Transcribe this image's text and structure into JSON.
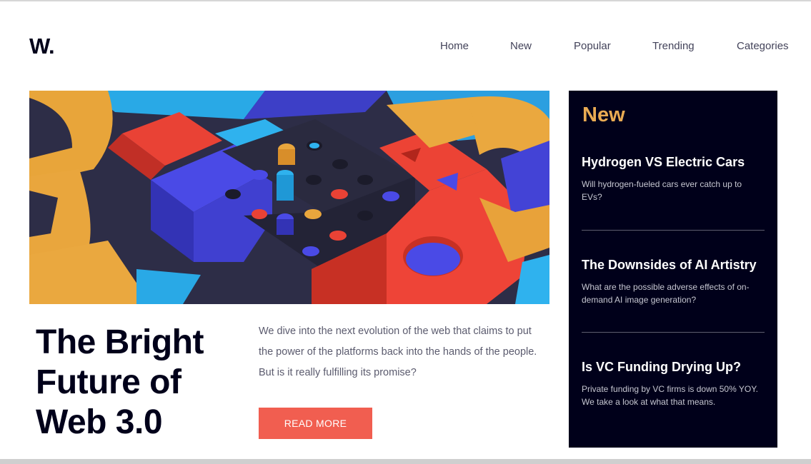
{
  "site": {
    "logo": "W."
  },
  "nav": {
    "items": [
      {
        "label": "Home"
      },
      {
        "label": "New"
      },
      {
        "label": "Popular"
      },
      {
        "label": "Trending"
      },
      {
        "label": "Categories"
      }
    ]
  },
  "hero": {
    "headline": "The Bright Future of Web 3.0",
    "summary": "We dive into the next evolution of the web that claims to put the power of the platforms back into the hands of the people. But is it really fulfilling its promise?",
    "button_label": "READ MORE"
  },
  "sidebar": {
    "title": "New",
    "items": [
      {
        "title": "Hydrogen VS Electric Cars",
        "description": "Will hydrogen-fueled cars ever catch up to EVs?"
      },
      {
        "title": "The Downsides of AI Artistry",
        "description": "What are the possible adverse effects of on-demand AI image generation?"
      },
      {
        "title": "Is VC Funding Drying Up?",
        "description": "Private funding by VC firms is down 50% YOY. We take a look at what that means."
      }
    ]
  },
  "colors": {
    "accent": "#f15e50",
    "sidebar_bg": "#00001a",
    "sidebar_heading": "#e9ab53",
    "text_dark": "#00001a"
  }
}
